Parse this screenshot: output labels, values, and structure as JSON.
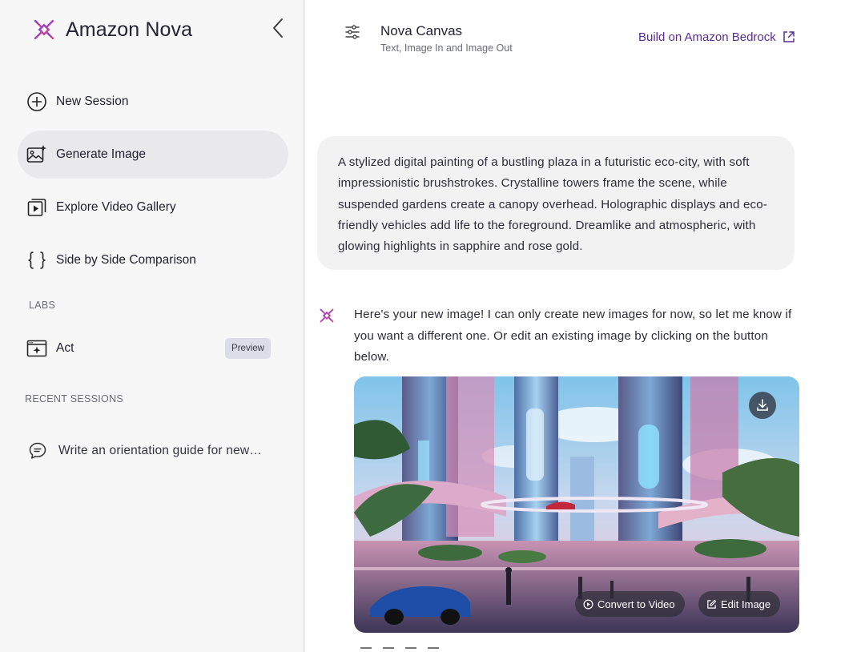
{
  "brand": {
    "name": "Amazon Nova"
  },
  "sidebar": {
    "items": [
      {
        "label": "New Session",
        "icon": "plus-circle-icon"
      },
      {
        "label": "Generate Image",
        "icon": "image-sparkle-icon",
        "active": true
      },
      {
        "label": "Explore Video Gallery",
        "icon": "video-gallery-icon"
      },
      {
        "label": "Side by Side Comparison",
        "icon": "curly-braces-icon"
      }
    ],
    "labs_label": "LABS",
    "labs_items": [
      {
        "label": "Act",
        "icon": "browser-sparkle-icon",
        "badge": "Preview"
      }
    ],
    "recent_label": "RECENT SESSIONS",
    "recent_items": [
      {
        "label": "Write an orientation guide for new…",
        "icon": "chat-bubble-icon"
      }
    ]
  },
  "header": {
    "model_name": "Nova Canvas",
    "model_subtitle": "Text, Image In and Image Out",
    "bedrock_link": "Build on Amazon Bedrock"
  },
  "conversation": {
    "prompt": "A stylized digital painting of a bustling plaza in a futuristic eco-city, with soft impressionistic brushstrokes. Crystalline towers frame the scene, while suspended gardens create a canopy overhead. Holographic displays and eco-friendly vehicles add life to the foreground. Dreamlike and atmospheric, with glowing highlights in sapphire and rose gold.",
    "response": "Here's your new image! I can only create new images for now, so let me know if you want a different one. Or edit an existing image by clicking on the button below.",
    "image_actions": {
      "convert": "Convert to Video",
      "edit": "Edit Image"
    }
  },
  "colors": {
    "brand_purple": "#5c2d91",
    "logo_gradient_start": "#8a3fd1",
    "logo_gradient_end": "#e0457b",
    "sidebar_bg": "#f7f7f8",
    "active_item_bg": "#e9e9ec"
  }
}
